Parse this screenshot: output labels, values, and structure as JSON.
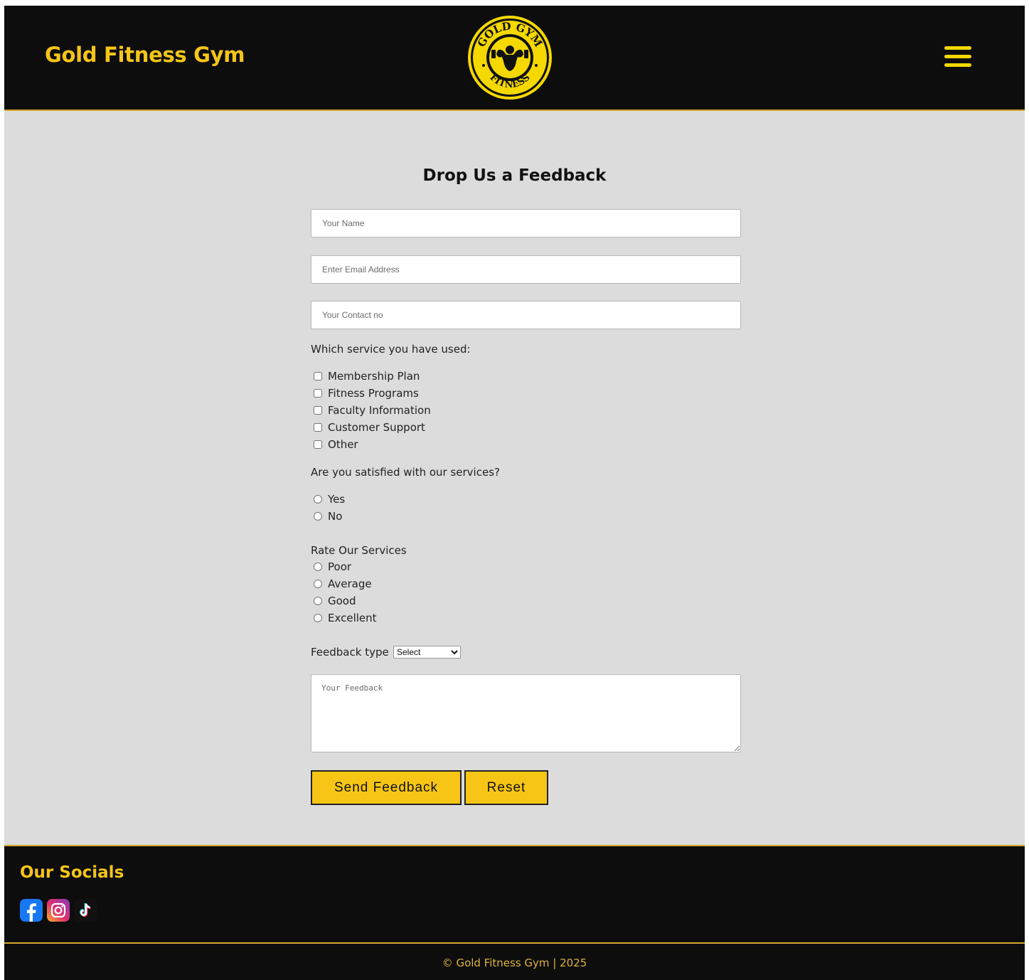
{
  "header": {
    "brand": "Gold Fitness Gym",
    "logo_top_text": "GOLD GYM",
    "logo_bottom_text": "FITNESS",
    "menu_icon": "hamburger-icon"
  },
  "form": {
    "title": "Drop Us a Feedback",
    "name_placeholder": "Your Name",
    "email_placeholder": "Enter Email Address",
    "contact_placeholder": "Your Contact no",
    "services_label": "Which service you have used:",
    "services": [
      "Membership Plan",
      "Fitness Programs",
      "Faculty Information",
      "Customer Support",
      "Other"
    ],
    "satisfied_label": "Are you satisfied with our services?",
    "satisfied_options": [
      "Yes",
      "No"
    ],
    "rate_label": "Rate Our Services",
    "rate_options": [
      "Poor",
      "Average",
      "Good",
      "Excellent"
    ],
    "feedback_type_label": "Feedback type",
    "feedback_type_selected": "Select",
    "feedback_placeholder": "Your Feedback",
    "send_label": "Send Feedback",
    "reset_label": "Reset"
  },
  "footer": {
    "socials_title": "Our Socials",
    "socials": [
      "facebook-icon",
      "instagram-icon",
      "tiktok-icon"
    ],
    "copyright": "© Gold Fitness Gym | 2025"
  },
  "colors": {
    "header_bg": "#0d0d0d",
    "brand_gold": "#f5c518",
    "accent_border": "#d4a72c",
    "page_bg": "#dcdcdc",
    "button_yellow": "#f7c515"
  }
}
